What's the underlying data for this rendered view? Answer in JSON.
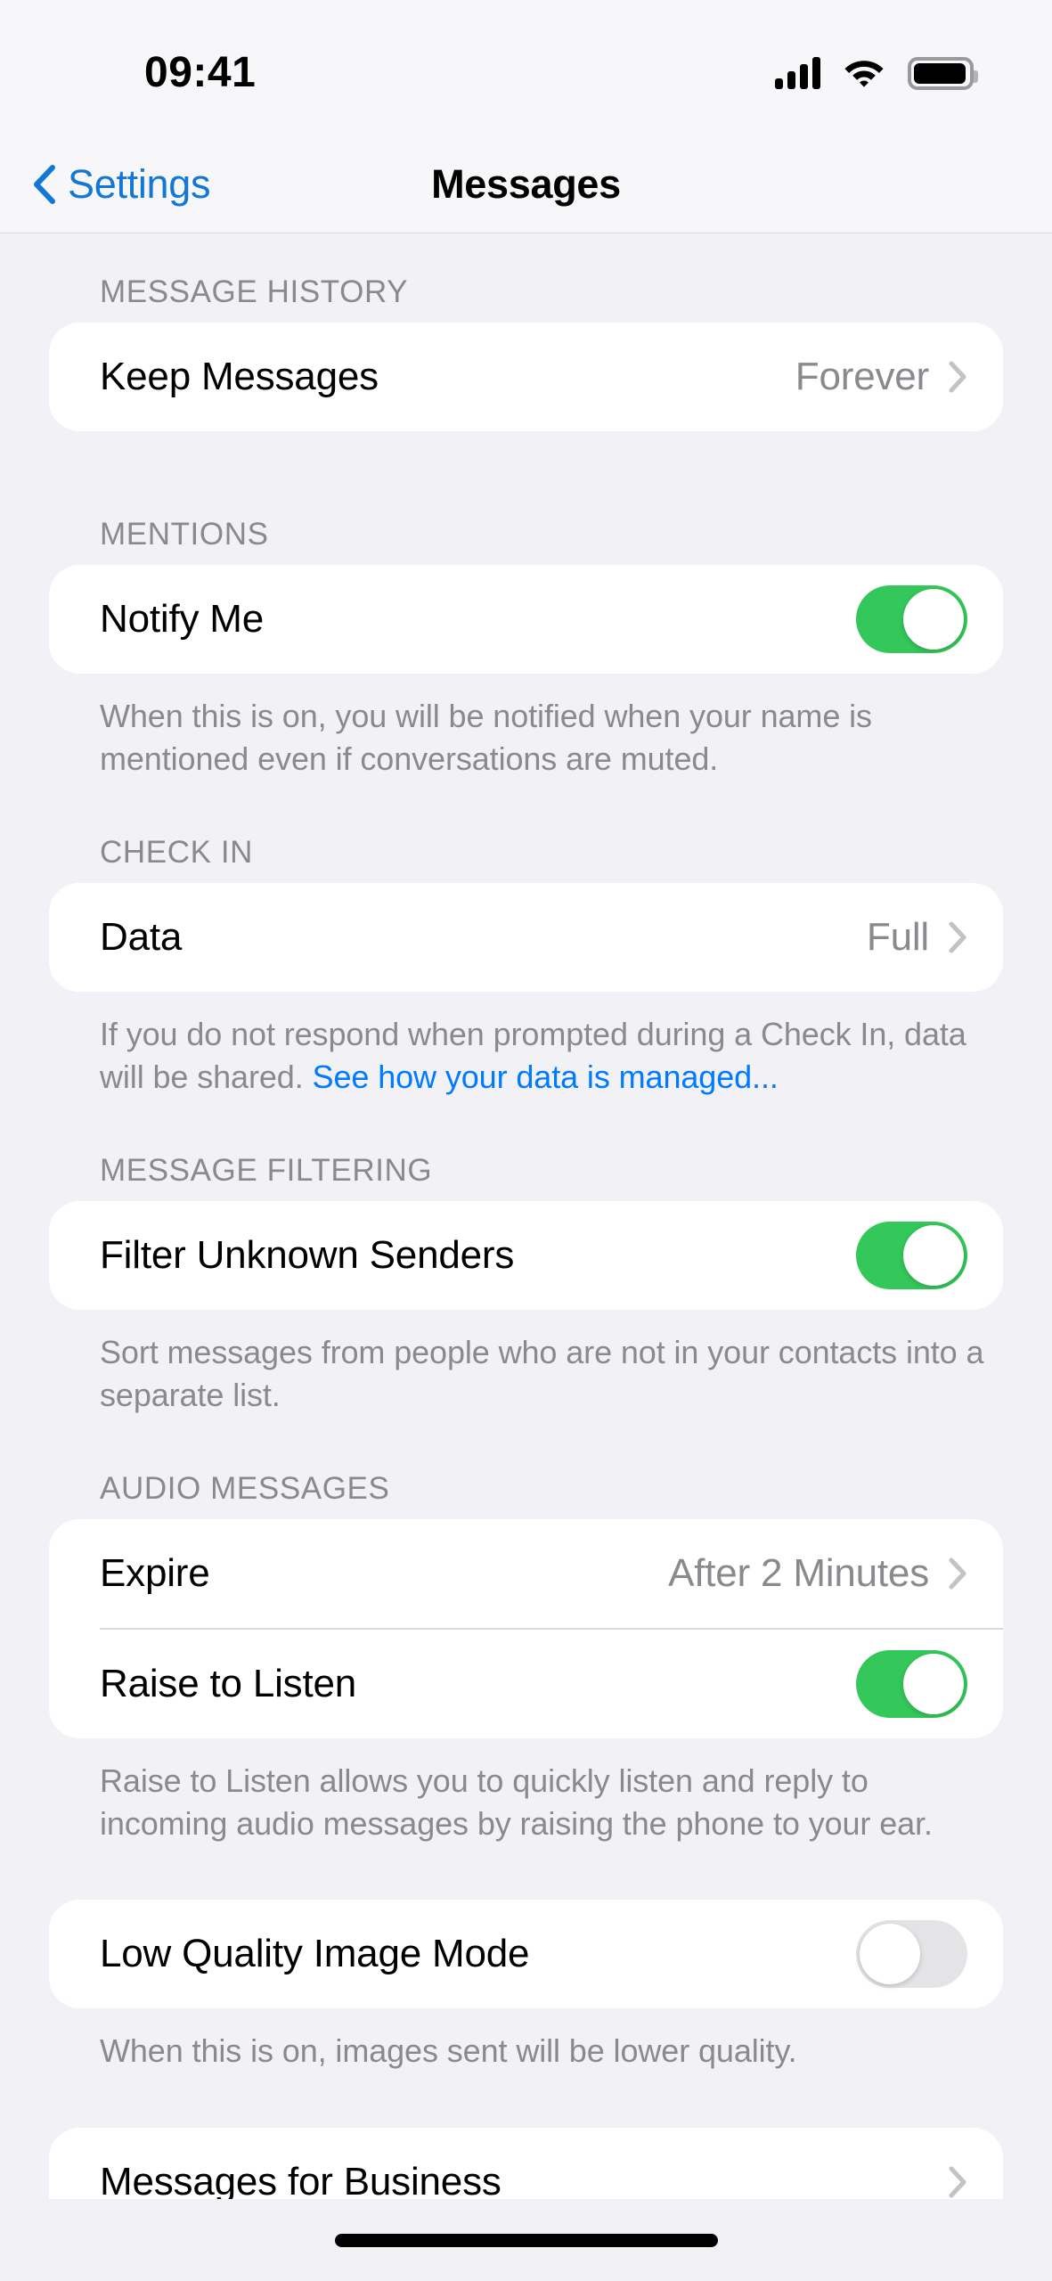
{
  "status_bar": {
    "time": "09:41",
    "cellular_icon": "cellular-signal-icon",
    "wifi_icon": "wifi-icon",
    "battery_icon": "battery-icon",
    "signal_bars": 4,
    "battery_full": true
  },
  "nav": {
    "back_label": "Settings",
    "back_icon": "chevron-left-icon",
    "title": "Messages"
  },
  "colors": {
    "accent_blue": "#007AFF",
    "back_blue": "#1278D4",
    "toggle_on_green": "#34C759",
    "toggle_off_gray": "#E4E4E7",
    "page_background": "#F1F1F6",
    "card_background": "#FFFFFF",
    "secondary_text": "#8A8A8E"
  },
  "sections": [
    {
      "header": "MESSAGE HISTORY",
      "rows": [
        {
          "label": "Keep Messages",
          "value": "Forever",
          "type": "disclosure"
        }
      ],
      "footer": ""
    },
    {
      "header": "MENTIONS",
      "rows": [
        {
          "label": "Notify Me",
          "type": "toggle",
          "state": "on"
        }
      ],
      "footer": "When this is on, you will be notified when your name is mentioned even if conversations are muted."
    },
    {
      "header": "CHECK IN",
      "rows": [
        {
          "label": "Data",
          "value": "Full",
          "type": "disclosure"
        }
      ],
      "footer_prefix": "If you do not respond when prompted during a Check In, data will be shared. ",
      "footer_link": "See how your data is managed..."
    },
    {
      "header": "MESSAGE FILTERING",
      "rows": [
        {
          "label": "Filter Unknown Senders",
          "type": "toggle",
          "state": "on"
        }
      ],
      "footer": "Sort messages from people who are not in your contacts into a separate list."
    },
    {
      "header": "AUDIO MESSAGES",
      "rows": [
        {
          "label": "Expire",
          "value": "After 2 Minutes",
          "type": "disclosure"
        },
        {
          "label": "Raise to Listen",
          "type": "toggle",
          "state": "on"
        }
      ],
      "footer": "Raise to Listen allows you to quickly listen and reply to incoming audio messages by raising the phone to your ear."
    },
    {
      "header": "",
      "rows": [
        {
          "label": "Low Quality Image Mode",
          "type": "toggle",
          "state": "off"
        }
      ],
      "footer": "When this is on, images sent will be lower quality."
    },
    {
      "header": "",
      "rows": [
        {
          "label": "Messages for Business",
          "value": "",
          "type": "disclosure"
        }
      ],
      "footer": ""
    }
  ]
}
